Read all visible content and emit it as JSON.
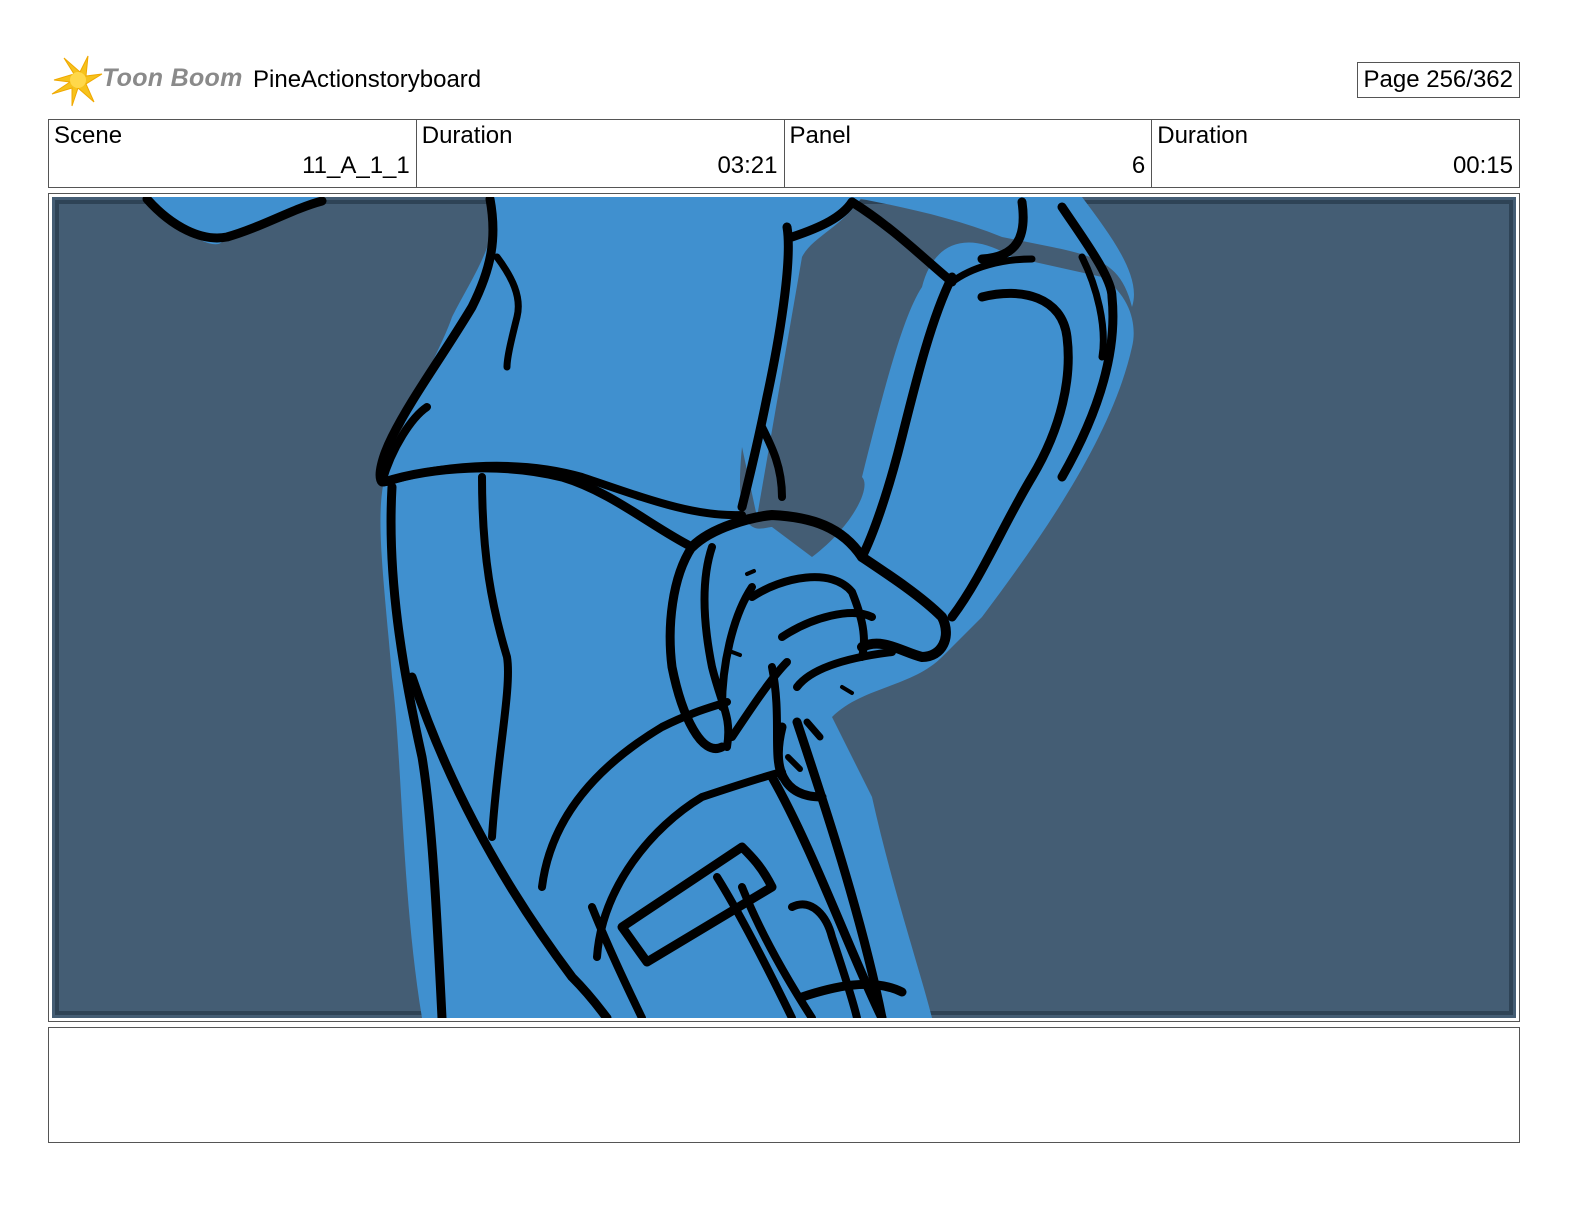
{
  "header": {
    "logo_text": "Toon Boom",
    "project_title": "PineActionstoryboard",
    "page_label": "Page 256/362"
  },
  "info": [
    {
      "label": "Scene",
      "value": "11_A_1_1"
    },
    {
      "label": "Duration",
      "value": "03:21"
    },
    {
      "label": "Panel",
      "value": "6"
    },
    {
      "label": "Duration",
      "value": "00:15"
    }
  ],
  "panel": {
    "background_color": "#445d74",
    "figure_color": "#4090cf",
    "line_color": "#000000"
  },
  "notes": {
    "text": ""
  }
}
